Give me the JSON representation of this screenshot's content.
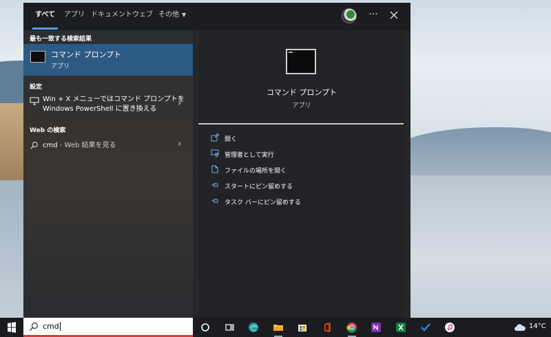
{
  "search_panel": {
    "tabs": [
      {
        "label": "すべて",
        "active": true
      },
      {
        "label": "アプリ"
      },
      {
        "label": "ドキュメント"
      },
      {
        "label": "ウェブ"
      },
      {
        "label": "その他"
      }
    ],
    "left": {
      "best_match_heading": "最も一致する検索結果",
      "best_match": {
        "title": "コマンド プロンプト",
        "subtitle": "アプリ",
        "icon": "command-prompt-icon"
      },
      "settings_heading": "設定",
      "settings_item": {
        "line1": "Win + X メニューではコマンド プロンプトを",
        "line2": "Windows PowerShell に置き換える",
        "icon": "monitor-icon"
      },
      "web_heading": "Web の検索",
      "web_item": {
        "query": "cmd",
        "suffix": " - Web 結果を見る",
        "icon": "search-icon"
      }
    },
    "right": {
      "title": "コマンド プロンプト",
      "subtitle": "アプリ",
      "actions": [
        {
          "label": "開く",
          "icon": "open-icon"
        },
        {
          "label": "管理者として実行",
          "icon": "admin-shield-icon"
        },
        {
          "label": "ファイルの場所を開く",
          "icon": "file-location-icon"
        },
        {
          "label": "スタートにピン留めする",
          "icon": "pin-icon"
        },
        {
          "label": "タスク バーにピン留めする",
          "icon": "pin-icon"
        }
      ]
    }
  },
  "taskbar": {
    "search_value": "cmd",
    "apps": [
      "cortana-icon",
      "task-view-icon",
      "edge-icon",
      "file-explorer-icon",
      "microsoft-store-icon",
      "office-icon",
      "chrome-icon",
      "onenote-icon",
      "excel-icon",
      "todo-icon",
      "itunes-icon"
    ],
    "weather": {
      "temperature": "14°C",
      "icon": "cloud-icon"
    }
  },
  "colors": {
    "accent": "#4c9be8",
    "selection": "#2d5a83",
    "search_underline": "#d9383a"
  }
}
